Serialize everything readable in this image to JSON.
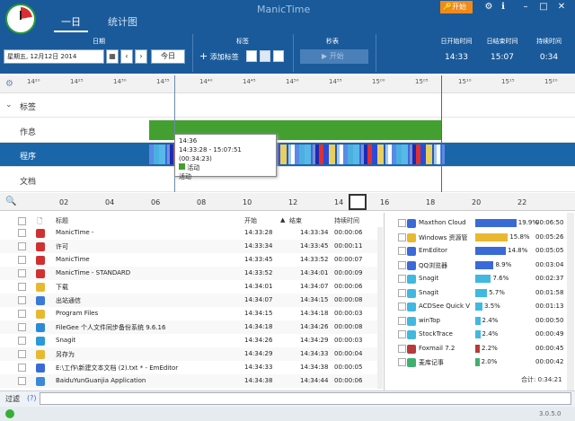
{
  "app": {
    "title": "ManicTime",
    "pro_label": "开始"
  },
  "tabs": [
    "一日",
    "统计图"
  ],
  "groups": {
    "date": "日期",
    "tags": "标签",
    "stopwatch": "秒表",
    "start_time": "日开始时间",
    "end_time": "日结束时间",
    "duration": "持续时间"
  },
  "date_value": "星期五, 12月12日 2014",
  "today_btn": "今日",
  "add_tag": "添加标签",
  "start_btn": "开始",
  "times": {
    "start": "14:33",
    "end": "15:07",
    "duration": "0:34"
  },
  "ruler": [
    "14²⁰",
    "14²⁵",
    "14³⁰",
    "14³⁵",
    "14⁴⁰",
    "14⁴⁵",
    "14⁵⁰",
    "14⁵⁵",
    "15⁰⁰",
    "15⁰⁵",
    "15¹⁰",
    "15¹⁵",
    "15²⁰"
  ],
  "rows": [
    "标签",
    "作息",
    "程序",
    "文档"
  ],
  "tooltip": {
    "time": "14:36",
    "range": "14:33:28 - 15:07:51 (00:34:23)",
    "activity1": "活动",
    "activity2": "活动"
  },
  "timeline2": [
    "02",
    "04",
    "06",
    "08",
    "10",
    "12",
    "14",
    "16",
    "18",
    "20",
    "22"
  ],
  "table_headers": {
    "title": "标题",
    "start": "开始",
    "end": "结束",
    "duration": "持续时间"
  },
  "table_rows": [
    {
      "title": "ManicTime -",
      "start": "14:33:28",
      "end": "14:33:34",
      "dur": "00:00:06",
      "icon": "manictime-icon",
      "color": "#d03030"
    },
    {
      "title": "许可",
      "start": "14:33:34",
      "end": "14:33:45",
      "dur": "00:00:11",
      "icon": "manictime-icon",
      "color": "#d03030"
    },
    {
      "title": "ManicTime",
      "start": "14:33:45",
      "end": "14:33:52",
      "dur": "00:00:07",
      "icon": "manictime-icon",
      "color": "#d03030"
    },
    {
      "title": "ManicTime - STANDARD",
      "start": "14:33:52",
      "end": "14:34:01",
      "dur": "00:00:09",
      "icon": "manictime-icon",
      "color": "#d03030"
    },
    {
      "title": "下载",
      "start": "14:34:01",
      "end": "14:34:07",
      "dur": "00:00:06",
      "icon": "folder-icon",
      "color": "#e8b830"
    },
    {
      "title": "出站通信",
      "start": "14:34:07",
      "end": "14:34:15",
      "dur": "00:00:08",
      "icon": "network-icon",
      "color": "#3a7ad8"
    },
    {
      "title": "Program Files",
      "start": "14:34:15",
      "end": "14:34:18",
      "dur": "00:00:03",
      "icon": "folder-icon",
      "color": "#e8b830"
    },
    {
      "title": "FileGee 个人文件同步备份系统 9.6.16",
      "start": "14:34:18",
      "end": "14:34:26",
      "dur": "00:00:08",
      "icon": "filegee-icon",
      "color": "#2a8ad8"
    },
    {
      "title": "Snagit",
      "start": "14:34:26",
      "end": "14:34:29",
      "dur": "00:00:03",
      "icon": "snagit-icon",
      "color": "#2a9ad8"
    },
    {
      "title": "另存为",
      "start": "14:34:29",
      "end": "14:34:33",
      "dur": "00:00:04",
      "icon": "folder-icon",
      "color": "#e8b830"
    },
    {
      "title": "E:\\工作\\新建文本文档 (2).txt * - EmEditor",
      "start": "14:34:33",
      "end": "14:34:38",
      "dur": "00:00:05",
      "icon": "emeditor-icon",
      "color": "#3a6ad8"
    },
    {
      "title": "BaiduYunGuanjia Application",
      "start": "14:34:38",
      "end": "14:34:44",
      "dur": "00:00:06",
      "icon": "baidu-icon",
      "color": "#3a8ad8"
    }
  ],
  "stats": [
    {
      "name": "Maxthon Cloud",
      "pct": "19.9%",
      "pval": 19.9,
      "dur": "00:06:50",
      "color": "#3a6ad8"
    },
    {
      "name": "Windows 资源管",
      "pct": "15.8%",
      "pval": 15.8,
      "dur": "00:05:26",
      "color": "#e8b830"
    },
    {
      "name": "EmEditor",
      "pct": "14.8%",
      "pval": 14.8,
      "dur": "00:05:05",
      "color": "#3a6ad8"
    },
    {
      "name": "QQ浏览器",
      "pct": "8.9%",
      "pval": 8.9,
      "dur": "00:03:04",
      "color": "#3a6ad8"
    },
    {
      "name": "Snagit",
      "pct": "7.6%",
      "pval": 7.6,
      "dur": "00:02:37",
      "color": "#40b8e0"
    },
    {
      "name": "Snagit",
      "pct": "5.7%",
      "pval": 5.7,
      "dur": "00:01:58",
      "color": "#40b8e0"
    },
    {
      "name": "ACDSee Quick V",
      "pct": "3.5%",
      "pval": 3.5,
      "dur": "00:01:13",
      "color": "#40b8e0"
    },
    {
      "name": "winTop",
      "pct": "2.4%",
      "pval": 2.4,
      "dur": "00:00:50",
      "color": "#40b8e0"
    },
    {
      "name": "StockTrace",
      "pct": "2.4%",
      "pval": 2.4,
      "dur": "00:00:49",
      "color": "#40b8e0"
    },
    {
      "name": "Foxmail 7.2",
      "pct": "2.2%",
      "pval": 2.2,
      "dur": "00:00:45",
      "color": "#b83a3a"
    },
    {
      "name": "麦库记事",
      "pct": "2.0%",
      "pval": 2.0,
      "dur": "00:00:42",
      "color": "#40b070"
    }
  ],
  "total": "合计: 0:34:21",
  "filter_label": "过滤",
  "filter_help": "(?)",
  "version": "3.0.5.0"
}
